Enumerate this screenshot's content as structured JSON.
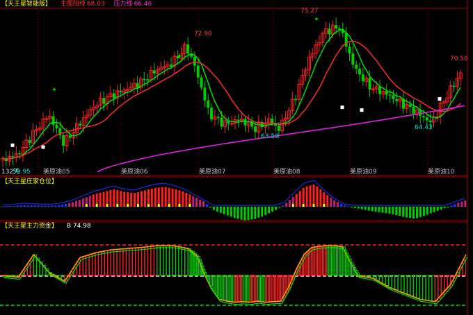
{
  "panel1": {
    "title": "【天王星智能版】",
    "indicators": [
      {
        "label": "主图阳线",
        "value": "68.03",
        "color": "#ff3333"
      },
      {
        "label": "压力线",
        "value": "66.46",
        "color": "#ff33cc"
      }
    ],
    "y_left_label": "132天",
    "low_label": "59.95",
    "price_labels": [
      "72.90",
      "75.27",
      "63.59",
      "64.43",
      "70.50"
    ],
    "x_labels": [
      "美原油05",
      "美原油06",
      "美原油07",
      "美原油08",
      "美原油09",
      "美原油10"
    ]
  },
  "panel2": {
    "title": "【天王星庄家仓位】"
  },
  "panel3": {
    "title": "【天王星主力资金】",
    "value_label": "B 74.98"
  },
  "colors": {
    "up": "#ff2020",
    "down": "#00cc00",
    "ma_short": "#00e000",
    "ma_mid": "#ff2a2a",
    "ma_long": "#e020e0",
    "grid": "#880000",
    "gold": "#ffff00",
    "magenta": "#ff00ff",
    "blue": "#2030ff",
    "cyan": "#00e0e0",
    "white": "#ffffff",
    "pink": "#ffc0ff",
    "orange": "#ff9900"
  },
  "chart_data": [
    {
      "type": "candlestick",
      "title": "【天王星智能版】",
      "x_tick_labels": [
        "美原油05",
        "美原油06",
        "美原油07",
        "美原油08",
        "美原油09",
        "美原油10"
      ],
      "ylim": [
        59,
        77
      ],
      "annotations": [
        {
          "text": "72.90",
          "x": "美原油06-07",
          "y": 72.9
        },
        {
          "text": "75.27",
          "x": "美原油08",
          "y": 75.27
        },
        {
          "text": "63.59",
          "x": "美原油08",
          "y": 63.59
        },
        {
          "text": "64.43",
          "x": "美原油10",
          "y": 64.43
        },
        {
          "text": "70.50",
          "x": "美原油10",
          "y": 70.5
        },
        {
          "text": "59.95",
          "x": "美原油05",
          "y": 59.95
        }
      ],
      "price_curve_x": [
        0,
        10,
        20,
        30,
        40,
        50,
        60,
        70,
        80,
        90,
        100,
        110,
        120,
        126,
        135,
        145,
        155,
        165,
        175,
        180,
        190,
        200,
        210,
        220,
        230,
        240,
        250,
        260,
        270,
        280,
        290,
        300
      ],
      "price_curve_y": [
        60.6,
        61.2,
        63.5,
        65.5,
        62.4,
        64.5,
        66.5,
        67.5,
        68.2,
        69.0,
        70.3,
        71.0,
        72.9,
        70.5,
        65.5,
        64.5,
        65.0,
        64.0,
        65.0,
        63.8,
        67.0,
        71.5,
        74.5,
        75.0,
        70.5,
        68.5,
        67.8,
        66.8,
        65.8,
        64.6,
        67.5,
        70.2
      ],
      "series": [
        {
          "name": "主图阳线",
          "last_value": 68.03,
          "color": "#ff2a2a"
        },
        {
          "name": "压力线",
          "last_value": 66.46,
          "color": "#e020e0"
        }
      ]
    },
    {
      "type": "bar",
      "title": "【天王星庄家仓位】",
      "ylim": [
        -1,
        1
      ],
      "values": [
        0.02,
        0.03,
        0.08,
        0.06,
        0.04,
        0.05,
        0.1,
        0.2,
        0.35,
        0.5,
        0.6,
        0.7,
        0.6,
        0.55,
        0.65,
        0.75,
        0.8,
        0.72,
        0.6,
        0.4,
        0.2,
        -0.15,
        -0.3,
        -0.45,
        -0.55,
        -0.5,
        -0.35,
        -0.15,
        0.1,
        0.45,
        0.8,
        0.9,
        0.55,
        0.25,
        0.05,
        -0.05,
        -0.12,
        -0.2,
        -0.25,
        -0.32,
        -0.42,
        -0.48,
        -0.35,
        -0.2,
        -0.05,
        0.12,
        0.25
      ]
    },
    {
      "type": "line",
      "title": "【天王星主力资金】",
      "series": [
        {
          "name": "B",
          "last_value": 74.98,
          "x": [
            0,
            10,
            20,
            30,
            40,
            50,
            60,
            70,
            80,
            90,
            100,
            110,
            120,
            126,
            130,
            135,
            140,
            145,
            150,
            155,
            160,
            165,
            170,
            175,
            180,
            185,
            190,
            195,
            200,
            205,
            210,
            215,
            220,
            225,
            230,
            240,
            250,
            260,
            270,
            280,
            290,
            300
          ],
          "values": [
            50,
            47,
            85,
            55,
            40,
            80,
            88,
            93,
            95,
            97,
            100,
            100,
            95,
            82,
            55,
            28,
            10,
            7,
            5,
            6,
            5,
            7,
            5,
            6,
            7,
            30,
            60,
            85,
            97,
            99,
            100,
            100,
            98,
            72,
            50,
            45,
            30,
            20,
            10,
            6,
            35,
            85
          ]
        }
      ]
    }
  ]
}
